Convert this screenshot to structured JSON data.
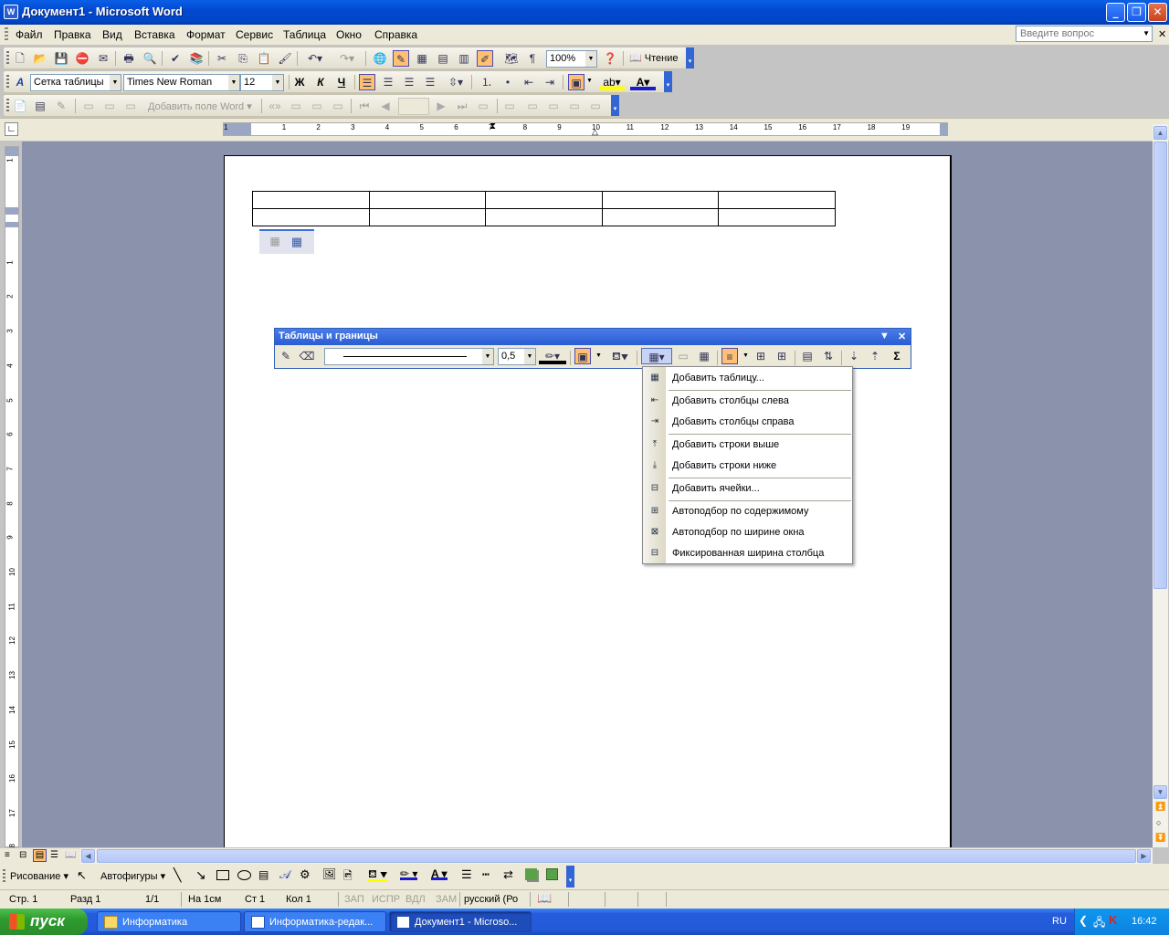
{
  "window": {
    "title": "Документ1 - Microsoft Word",
    "app_icon": "word-icon"
  },
  "menu": [
    "Файл",
    "Правка",
    "Вид",
    "Вставка",
    "Формат",
    "Сервис",
    "Таблица",
    "Окно",
    "Справка"
  ],
  "ask_box": {
    "placeholder": "Введите вопрос"
  },
  "standard_toolbar": {
    "zoom": "100%",
    "read_label": "Чтение"
  },
  "formatting_toolbar": {
    "style": "Сетка таблицы",
    "font": "Times New Roman",
    "size": "12",
    "bold": "Ж",
    "italic": "К",
    "underline": "Ч"
  },
  "third_toolbar": {
    "add_field_label": "Добавить поле Word"
  },
  "ruler": {
    "h_numbers": [
      "1",
      "1",
      "2",
      "3",
      "4",
      "5",
      "6",
      "7",
      "8",
      "9",
      "10",
      "11",
      "12",
      "13",
      "14",
      "15",
      "16",
      "17",
      "18",
      "19"
    ],
    "v_numbers": [
      "1",
      "1",
      "2",
      "3",
      "4",
      "5",
      "6",
      "7",
      "8",
      "9",
      "10",
      "11",
      "12",
      "13",
      "14",
      "15",
      "16",
      "17",
      "18"
    ]
  },
  "document_table": {
    "rows": 2,
    "cols": 5
  },
  "tables_toolbar": {
    "title": "Таблицы и границы",
    "line_weight": "0,5",
    "sum_symbol": "Σ"
  },
  "table_menu": {
    "items": [
      {
        "label": "Добавить таблицу...",
        "icon": "table-insert-icon"
      },
      {
        "label": "Добавить столбцы слева",
        "icon": "columns-left-icon"
      },
      {
        "label": "Добавить столбцы справа",
        "icon": "columns-right-icon"
      },
      {
        "label": "Добавить строки выше",
        "icon": "rows-above-icon"
      },
      {
        "label": "Добавить строки ниже",
        "icon": "rows-below-icon"
      },
      {
        "label": "Добавить ячейки...",
        "icon": "cells-insert-icon"
      },
      {
        "label": "Автоподбор по содержимому",
        "icon": "autofit-content-icon"
      },
      {
        "label": "Автоподбор по ширине окна",
        "icon": "autofit-window-icon"
      },
      {
        "label": "Фиксированная ширина столбца",
        "icon": "fixed-width-icon"
      }
    ]
  },
  "drawing_toolbar": {
    "draw_label": "Рисование",
    "autoshapes_label": "Автофигуры"
  },
  "status_bar": {
    "page": "Стр. 1",
    "section": "Разд 1",
    "pages": "1/1",
    "at": "На 1см",
    "line": "Ст 1",
    "col": "Кол 1",
    "rec": "ЗАП",
    "trk": "ИСПР",
    "ext": "ВДЛ",
    "ovr": "ЗАМ",
    "lang": "русский (Ро"
  },
  "taskbar": {
    "start": "пуск",
    "tasks": [
      "Информатика",
      "Информатика-редак...",
      "Документ1 - Microso..."
    ],
    "lang": "RU",
    "clock": "16:42"
  },
  "colors": {
    "title_blue": "#0349d0",
    "menu_bg": "#ece9d8",
    "doc_bg": "#8a93ab",
    "highlight": "#ffc073",
    "taskbar": "#245cdc",
    "start_green": "#2e9b2e"
  }
}
